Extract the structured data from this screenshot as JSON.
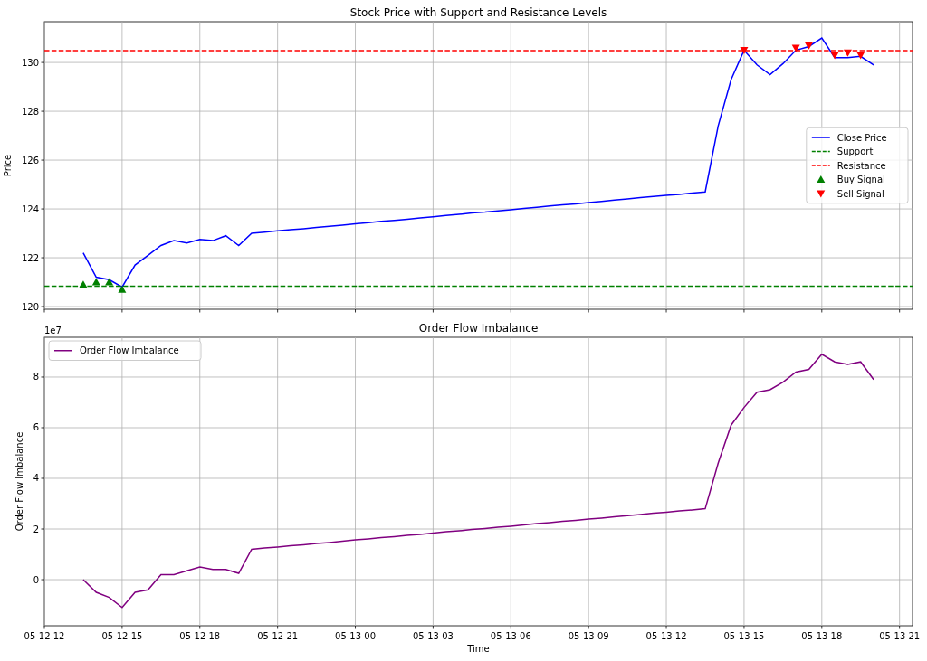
{
  "figure": {
    "panels": [
      {
        "chart_data": {
          "type": "line",
          "title": "Stock Price with Support and Resistance Levels",
          "ylabel": "Price",
          "categories": [
            null,
            null,
            null,
            null,
            null,
            null,
            null,
            null,
            null,
            null,
            null,
            null,
            null,
            null,
            null,
            null,
            null,
            null,
            null,
            null,
            null,
            null,
            null,
            null,
            null,
            null,
            null,
            null,
            null,
            null,
            null,
            null,
            null,
            null,
            null,
            null,
            null,
            null,
            null,
            null,
            null,
            null,
            null,
            null,
            null,
            null,
            null,
            null,
            null,
            null,
            null,
            null,
            null,
            null,
            null,
            null,
            null,
            null,
            null,
            null,
            null,
            null,
            null,
            null,
            null,
            null,
            null,
            null
          ],
          "series": [
            {
              "name": "Close Price",
              "color": "#0000ff",
              "values": [
                null,
                null,
                null,
                122.2,
                121.2,
                121.1,
                120.8,
                121.7,
                122.1,
                122.5,
                122.7,
                122.6,
                122.75,
                122.7,
                122.9,
                122.5,
                123.0,
                123.05,
                123.1,
                123.15,
                123.19,
                123.24,
                123.29,
                123.34,
                123.39,
                123.44,
                123.49,
                123.53,
                123.58,
                123.63,
                123.68,
                123.73,
                123.78,
                123.83,
                123.87,
                123.92,
                123.97,
                124.02,
                124.07,
                124.12,
                124.17,
                124.21,
                124.26,
                124.31,
                124.36,
                124.41,
                124.46,
                124.51,
                124.56,
                124.6,
                124.65,
                124.7,
                127.4,
                129.3,
                130.5,
                129.9,
                129.5,
                129.95,
                130.5,
                130.65,
                131.0,
                130.2,
                130.2,
                130.25,
                129.9,
                null,
                null,
                null
              ]
            },
            {
              "name": "Buy Signal",
              "type": "scatter",
              "marker": "^",
              "color": "#008000",
              "values": [
                null,
                null,
                null,
                120.9,
                121.0,
                121.0,
                120.7,
                null,
                null,
                null,
                null,
                null,
                null,
                null,
                null,
                null,
                null,
                null,
                null,
                null,
                null,
                null,
                null,
                null,
                null,
                null,
                null,
                null,
                null,
                null,
                null,
                null,
                null,
                null,
                null,
                null,
                null,
                null,
                null,
                null,
                null,
                null,
                null,
                null,
                null,
                null,
                null,
                null,
                null,
                null,
                null,
                null,
                null,
                null,
                null,
                null,
                null,
                null,
                null,
                null,
                null,
                null,
                null,
                null,
                null,
                null,
                null,
                null
              ]
            },
            {
              "name": "Sell Signal",
              "type": "scatter",
              "marker": "v",
              "color": "#ff0000",
              "values": [
                null,
                null,
                null,
                null,
                null,
                null,
                null,
                null,
                null,
                null,
                null,
                null,
                null,
                null,
                null,
                null,
                null,
                null,
                null,
                null,
                null,
                null,
                null,
                null,
                null,
                null,
                null,
                null,
                null,
                null,
                null,
                null,
                null,
                null,
                null,
                null,
                null,
                null,
                null,
                null,
                null,
                null,
                null,
                null,
                null,
                null,
                null,
                null,
                null,
                null,
                null,
                null,
                null,
                null,
                130.5,
                null,
                null,
                null,
                130.6,
                130.7,
                null,
                130.3,
                130.4,
                130.3,
                null,
                null,
                null,
                null
              ]
            }
          ],
          "ref_lines": [
            {
              "axis": "y",
              "value": 120.83,
              "label": "Support",
              "color": "#008000"
            },
            {
              "axis": "y",
              "value": 130.48,
              "label": "Resistance",
              "color": "#ff0000"
            }
          ],
          "ylim": [
            119.89,
            131.67
          ],
          "yticks": [
            120,
            122,
            124,
            126,
            128,
            130
          ],
          "grid": true,
          "legend": true
        }
      },
      {
        "chart_data": {
          "type": "line",
          "title": "Order Flow Imbalance",
          "xlabel": "Time",
          "ylabel": "Order Flow Imbalance",
          "categories": [
            "05-12 12",
            null,
            null,
            null,
            null,
            null,
            "05-12 15",
            null,
            null,
            null,
            null,
            null,
            "05-12 18",
            null,
            null,
            null,
            null,
            null,
            "05-12 21",
            null,
            null,
            null,
            null,
            null,
            "05-13 00",
            null,
            null,
            null,
            null,
            null,
            "05-13 03",
            null,
            null,
            null,
            null,
            null,
            "05-13 06",
            null,
            null,
            null,
            null,
            null,
            "05-13 09",
            null,
            null,
            null,
            null,
            null,
            "05-13 12",
            null,
            null,
            null,
            null,
            null,
            "05-13 15",
            null,
            null,
            null,
            null,
            null,
            "05-13 18",
            null,
            null,
            null,
            null,
            null,
            "05-13 21",
            null
          ],
          "series": [
            {
              "name": "Order Flow Imbalance",
              "color": "#800080",
              "values": [
                null,
                null,
                null,
                0,
                -0.5,
                -0.7,
                -1.1,
                -0.5,
                -0.4,
                0.2,
                0.2,
                0.35,
                0.5,
                0.4,
                0.4,
                0.25,
                1.2,
                1.25,
                1.29,
                1.34,
                1.38,
                1.43,
                1.47,
                1.52,
                1.57,
                1.61,
                1.66,
                1.7,
                1.75,
                1.79,
                1.84,
                1.89,
                1.93,
                1.98,
                2.02,
                2.07,
                2.11,
                2.16,
                2.21,
                2.25,
                2.3,
                2.34,
                2.39,
                2.43,
                2.48,
                2.53,
                2.57,
                2.62,
                2.66,
                2.71,
                2.75,
                2.8,
                4.6,
                6.1,
                6.8,
                7.4,
                7.5,
                7.8,
                8.2,
                8.3,
                8.9,
                8.6,
                8.5,
                8.6,
                7.9,
                null,
                null,
                null
              ]
            }
          ],
          "ylim": [
            -1.82,
            9.57
          ],
          "yticks": [
            0,
            2,
            4,
            6,
            8
          ],
          "grid": true,
          "legend": true
        },
        "offset_label": "1e7"
      }
    ]
  }
}
